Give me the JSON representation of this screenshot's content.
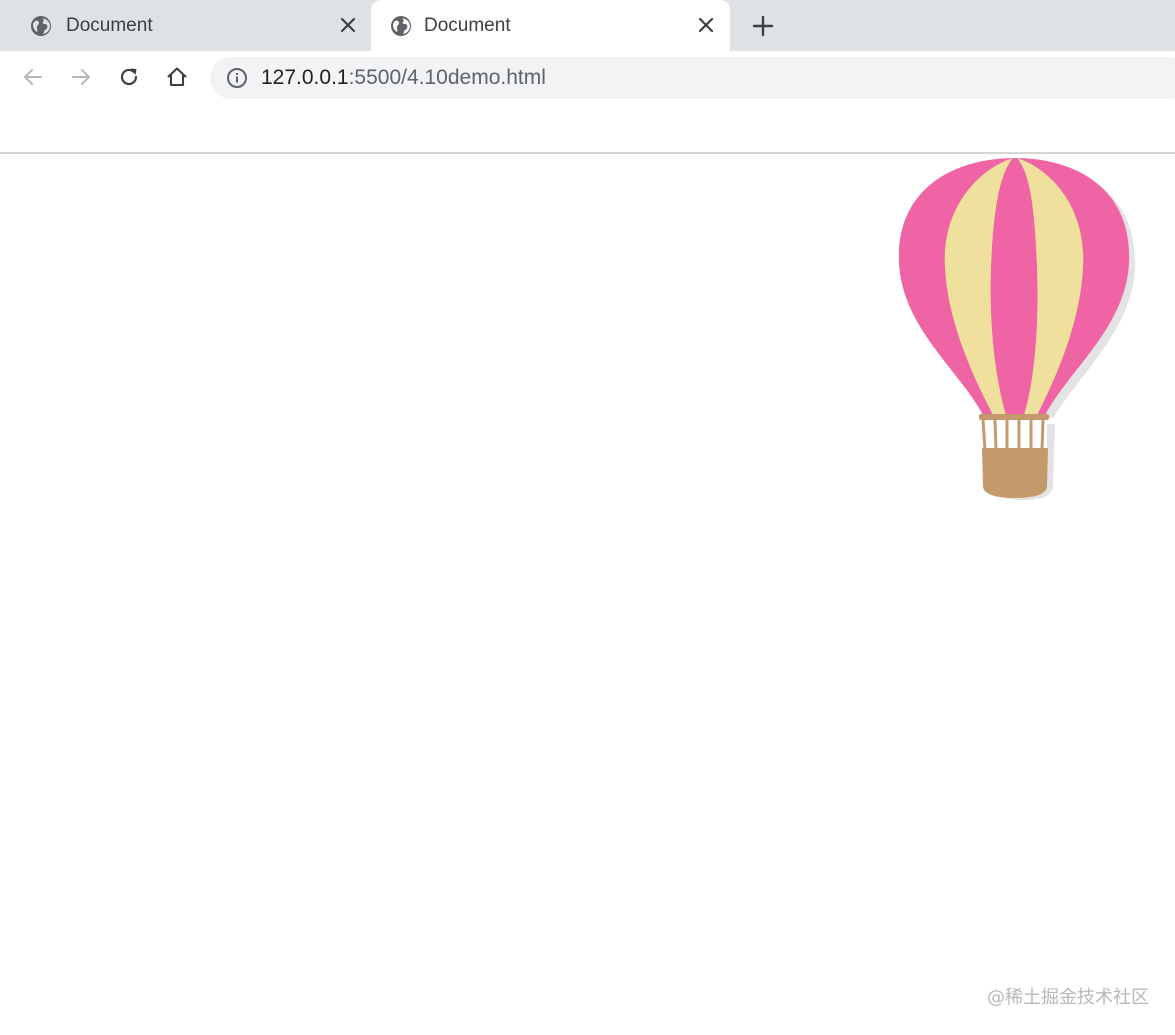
{
  "tabs": [
    {
      "title": "Document",
      "active": false,
      "icon": "globe-icon"
    },
    {
      "title": "Document",
      "active": true,
      "icon": "globe-icon"
    }
  ],
  "toolbar": {
    "back_icon": "arrow-left-icon",
    "forward_icon": "arrow-right-icon",
    "reload_icon": "reload-icon",
    "home_icon": "home-icon"
  },
  "address_bar": {
    "icon": "info-icon",
    "host": "127.0.0.1",
    "path": ":5500/4.10demo.html"
  },
  "page": {
    "illustration": "hot-air-balloon",
    "colors": {
      "balloon_pink": "#ee64a5",
      "balloon_yellow": "#efe19d",
      "basket": "#c49a6c",
      "shadow": "#e3e3e3"
    }
  },
  "watermark": "@稀土掘金技术社区"
}
